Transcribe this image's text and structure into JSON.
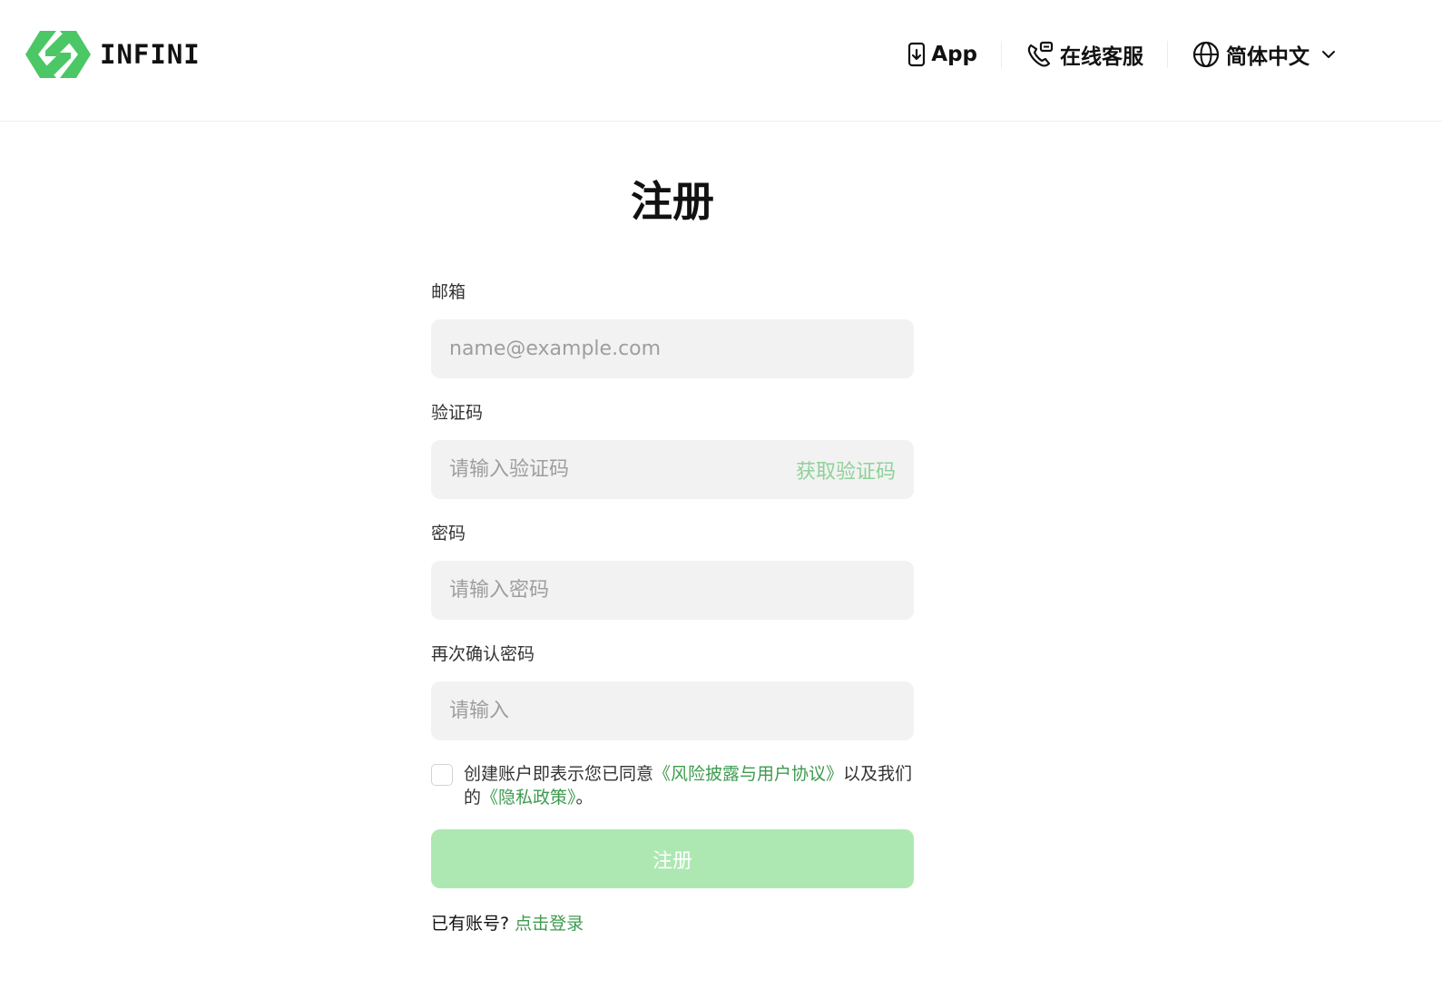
{
  "header": {
    "logo_text": "INFINI",
    "nav": {
      "app_label": "App",
      "support_label": "在线客服",
      "language_label": "简体中文"
    }
  },
  "page": {
    "title": "注册"
  },
  "form": {
    "email": {
      "label": "邮箱",
      "placeholder": "name@example.com",
      "value": ""
    },
    "code": {
      "label": "验证码",
      "placeholder": "请输入验证码",
      "value": "",
      "get_code_label": "获取验证码"
    },
    "password": {
      "label": "密码",
      "placeholder": "请输入密码",
      "value": ""
    },
    "confirm": {
      "label": "再次确认密码",
      "placeholder": "请输入",
      "value": ""
    },
    "agreement": {
      "checked": false,
      "text_prefix": "创建账户即表示您已同意",
      "terms_link": "《风险披露与用户协议》",
      "text_mid": "以及我们的",
      "privacy_link": "《隐私政策》",
      "text_suffix": "。"
    },
    "submit_label": "注册",
    "login_prompt": "已有账号?",
    "login_link": "点击登录"
  },
  "colors": {
    "brand_green": "#4cc765",
    "link_green": "#3e9b4f",
    "button_disabled": "#ade8b3",
    "input_bg": "#f2f2f2"
  },
  "icons": {
    "logo": "infini-logo-mark",
    "app": "phone-download-icon",
    "support": "phone-chat-icon",
    "language": "globe-icon",
    "dropdown": "chevron-down-icon"
  }
}
